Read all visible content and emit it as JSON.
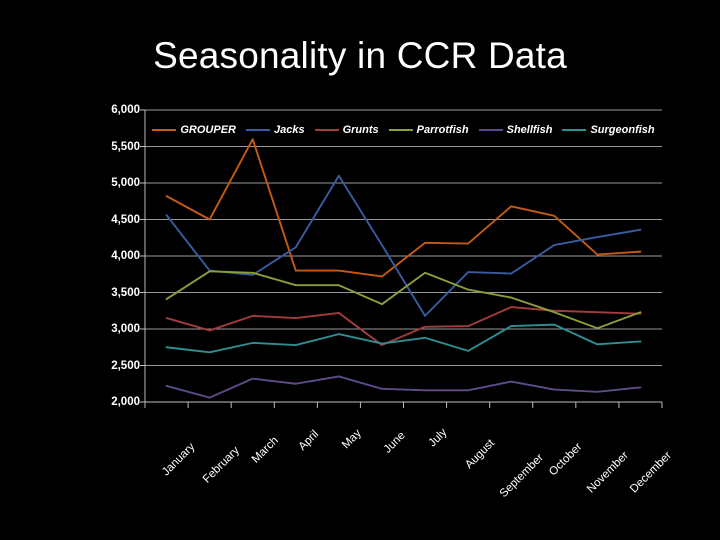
{
  "slide": {
    "background_color": "#000000",
    "title": "Seasonality in CCR Data"
  },
  "chart_data": {
    "type": "line",
    "title": "Seasonality in CCR Data",
    "xlabel": "",
    "ylabel": "",
    "ylim": [
      2000,
      6000
    ],
    "ytick_step": 500,
    "ytick_labels": [
      "6,000",
      "5,500",
      "5,000",
      "4,500",
      "4,000",
      "3,500",
      "3,000",
      "2,500",
      "2,000"
    ],
    "grid": true,
    "legend_position": "top-center",
    "categories": [
      "January",
      "February",
      "March",
      "April",
      "May",
      "June",
      "July",
      "August",
      "September",
      "October",
      "November",
      "December"
    ],
    "series": [
      {
        "name": "GROUPER",
        "color": "#C55A11",
        "values": [
          4820,
          4500,
          5600,
          3800,
          3800,
          3720,
          4180,
          4170,
          4680,
          4550,
          4020,
          4060
        ]
      },
      {
        "name": "Jacks",
        "color": "#3A5BA0",
        "values": [
          4560,
          3800,
          3740,
          4120,
          5100,
          4150,
          3180,
          3780,
          3760,
          4150,
          4260,
          4360
        ]
      },
      {
        "name": "Grunts",
        "color": "#A33C3C",
        "values": [
          3150,
          2980,
          3180,
          3150,
          3220,
          2780,
          3030,
          3040,
          3300,
          3250,
          3230,
          3210
        ]
      },
      {
        "name": "Parrotfish",
        "color": "#8B9E3A",
        "values": [
          3410,
          3790,
          3770,
          3600,
          3600,
          3340,
          3770,
          3540,
          3430,
          3230,
          3010,
          3230
        ]
      },
      {
        "name": "Shellfish",
        "color": "#5E4B8B",
        "values": [
          2220,
          2060,
          2320,
          2250,
          2350,
          2180,
          2160,
          2160,
          2280,
          2170,
          2140,
          2200
        ]
      },
      {
        "name": "Surgeonfish",
        "color": "#2E8E93",
        "values": [
          2750,
          2680,
          2810,
          2780,
          2930,
          2800,
          2880,
          2700,
          3040,
          3060,
          2790,
          2830
        ]
      }
    ]
  }
}
